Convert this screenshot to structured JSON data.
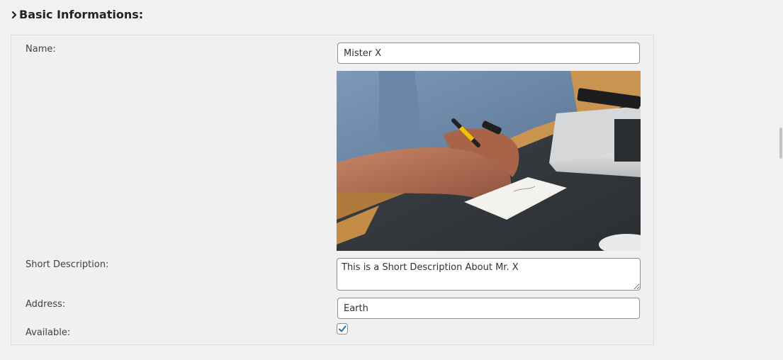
{
  "section": {
    "title": "Basic Informations:",
    "icon": "chevron-right-icon"
  },
  "form": {
    "name": {
      "label": "Name:",
      "value": "Mister X"
    },
    "photo": {
      "alt": "Person writing notes on paper next to a laptop"
    },
    "short_description": {
      "label": "Short Description:",
      "value": "This is a Short Description About Mr. X"
    },
    "address": {
      "label": "Address:",
      "value": "Earth"
    },
    "available": {
      "label": "Available:",
      "checked": true
    }
  },
  "colors": {
    "accent": "#2271b1",
    "panel_border": "#dcdcde",
    "background": "#f1f1f1"
  }
}
